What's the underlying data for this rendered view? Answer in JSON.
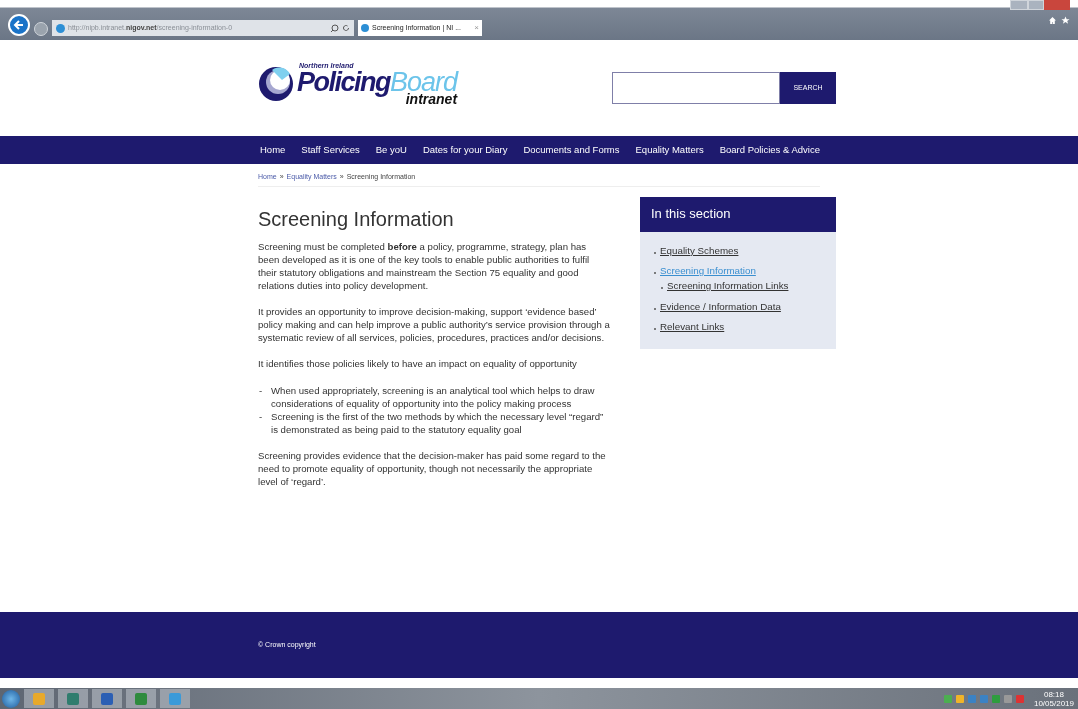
{
  "browser": {
    "url_prefix": "http://nipb.intranet.",
    "url_domain": "nigov.net",
    "url_path": "/screening-information-0",
    "tab_title": "Screening Information | NI ...",
    "tab_close": "×"
  },
  "logo": {
    "tagline": "Northern Ireland",
    "word_1": "Policing",
    "word_2": "Board",
    "sub": "intranet"
  },
  "search": {
    "button": "SEARCH"
  },
  "nav": [
    "Home",
    "Staff Services",
    "Be yoU",
    "Dates for your Diary",
    "Documents and Forms",
    "Equality Matters",
    "Board Policies & Advice"
  ],
  "breadcrumb": [
    {
      "label": "Home",
      "link": true
    },
    {
      "label": "»",
      "link": false
    },
    {
      "label": "Equality Matters",
      "link": true
    },
    {
      "label": "»",
      "link": false
    },
    {
      "label": "Screening Information",
      "link": false
    }
  ],
  "article": {
    "title": "Screening Information",
    "blocks": [
      {
        "kind": "para",
        "text": "Screening must be completed **before** a policy, programme, strategy, plan has been developed as it is one of the key tools to enable public authorities to fulfil their statutory obligations and mainstream the Section 75 equality and good relations duties into policy development."
      },
      {
        "kind": "para",
        "text": "It provides an opportunity to improve decision-making, support ‘evidence based’ policy making and can help improve a public authority’s service provision through a systematic review of all services, policies, procedures, practices and/or decisions."
      },
      {
        "kind": "para",
        "text": "It identifies those policies likely to have an impact on equality of opportunity"
      },
      {
        "kind": "list",
        "items": [
          {
            "marker": "-",
            "text": "When used appropriately, screening is an analytical tool which helps to draw considerations of equality of opportunity into the policy making process"
          },
          {
            "marker": "-",
            "text": "Screening is the first of the two methods by which the necessary level “regard” is demonstrated as being paid to the statutory equality goal"
          }
        ]
      },
      {
        "kind": "para",
        "text": "Screening provides evidence that the decision-maker has paid some regard to the need to promote equality of opportunity, though not necessarily the appropriate level of ‘regard’."
      }
    ]
  },
  "sidebar": {
    "title": "In this section",
    "items": [
      {
        "label": "Equality Schemes",
        "selected": false
      },
      {
        "label": "Screening Information",
        "selected": true,
        "children": [
          {
            "label": "Screening Information Links",
            "selected": false
          }
        ]
      },
      {
        "label": "Evidence / Information Data",
        "selected": false
      },
      {
        "label": "Relevant Links",
        "selected": false
      }
    ]
  },
  "footer": {
    "copyright": "© Crown copyright"
  },
  "taskbar": {
    "time": "08:18",
    "date": "10/05/2019"
  }
}
